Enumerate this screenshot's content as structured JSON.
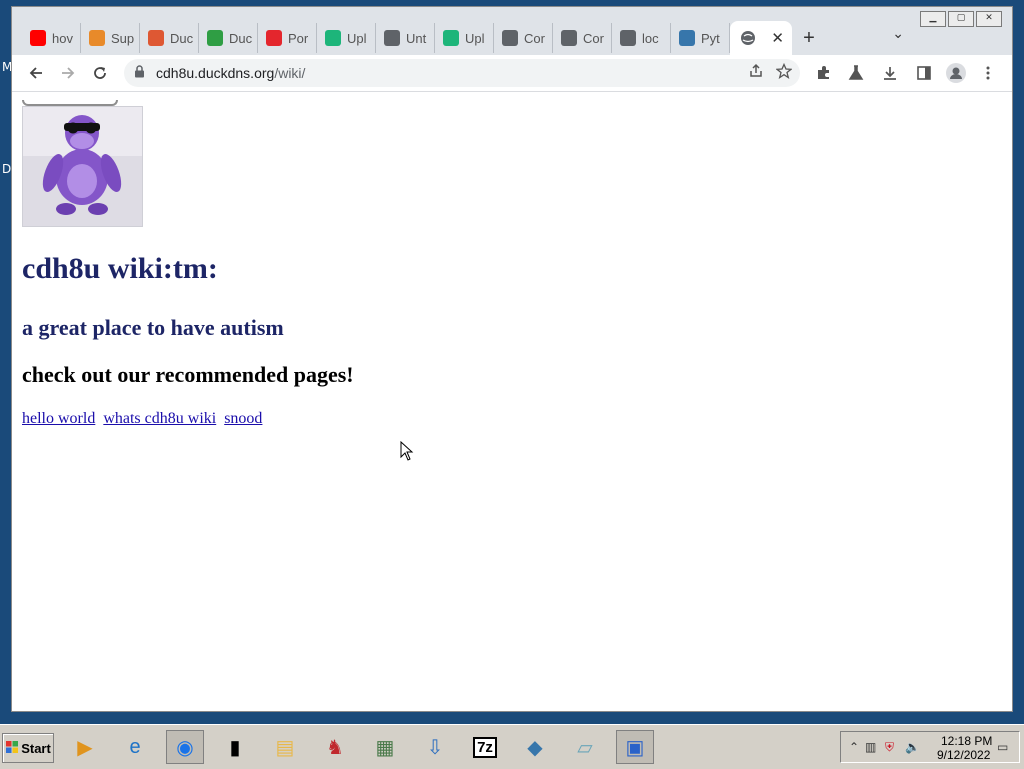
{
  "desktop": {
    "labels": [
      "M",
      "D"
    ]
  },
  "window": {
    "controls": [
      "▁",
      "▢",
      "✕"
    ]
  },
  "tabs": [
    {
      "label": "hov",
      "icon": "youtube-icon",
      "color": "#ff0000"
    },
    {
      "label": "Sup",
      "icon": "diamond-icon",
      "color": "#e88a2a"
    },
    {
      "label": "Duc",
      "icon": "duckduckgo-icon",
      "color": "#de5833"
    },
    {
      "label": "Duc",
      "icon": "chrome-web-icon",
      "color": "#2f9e44"
    },
    {
      "label": "Por",
      "icon": "pornhub-icon",
      "color": "#e4262d"
    },
    {
      "label": "Upl",
      "icon": "upload-icon",
      "color": "#1db57a"
    },
    {
      "label": "Unt",
      "icon": "globe-icon",
      "color": "#5f6368"
    },
    {
      "label": "Upl",
      "icon": "upload-icon",
      "color": "#1db57a"
    },
    {
      "label": "Cor",
      "icon": "globe-icon",
      "color": "#5f6368"
    },
    {
      "label": "Cor",
      "icon": "globe-icon",
      "color": "#5f6368"
    },
    {
      "label": "loc",
      "icon": "globe-icon",
      "color": "#5f6368"
    },
    {
      "label": "Pyt",
      "icon": "python-icon",
      "color": "#3776ab"
    }
  ],
  "active_tab": {
    "icon": "globe-icon",
    "close": "✕"
  },
  "new_tab": "+",
  "tab_search": "⌄",
  "address": {
    "host": "cdh8u.duckdns.org",
    "path": "/wiki/"
  },
  "page": {
    "title": "cdh8u wiki:tm:",
    "subtitle": "a great place to have autism",
    "recommend_heading": "check out our recommended pages!",
    "links": [
      "hello world",
      "whats cdh8u wiki",
      "snood"
    ]
  },
  "taskbar": {
    "start_label": "Start",
    "apps": [
      {
        "icon": "media-player-icon",
        "glyph": "▶",
        "color": "#e0941e"
      },
      {
        "icon": "internet-explorer-icon",
        "glyph": "e",
        "color": "#1e73c7"
      },
      {
        "icon": "chrome-icon",
        "glyph": "◉",
        "color": "#1a73e8",
        "selected": true
      },
      {
        "icon": "command-prompt-icon",
        "glyph": "▮",
        "color": "#000000"
      },
      {
        "icon": "file-explorer-icon",
        "glyph": "▤",
        "color": "#e8b84a"
      },
      {
        "icon": "racing-game-icon",
        "glyph": "♞",
        "color": "#c0282d"
      },
      {
        "icon": "system-monitor-icon",
        "glyph": "▦",
        "color": "#4a7a4a"
      },
      {
        "icon": "installer-icon",
        "glyph": "⇩",
        "color": "#2f6fbf"
      },
      {
        "icon": "7zip-icon",
        "glyph": "7z",
        "color": "#000000"
      },
      {
        "icon": "python-app-icon",
        "glyph": "◆",
        "color": "#3776ab"
      },
      {
        "icon": "notepad-icon",
        "glyph": "▱",
        "color": "#6aa5b8"
      },
      {
        "icon": "network-tool-icon",
        "glyph": "▣",
        "color": "#2a62c9",
        "selected": true
      }
    ],
    "clock_time": "12:18 PM",
    "clock_date": "9/12/2022"
  }
}
